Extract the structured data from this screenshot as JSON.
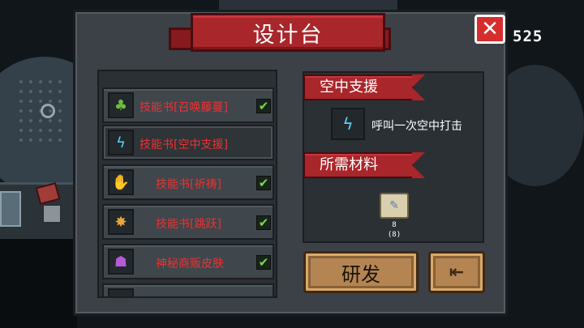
{
  "hud": {
    "score": "525"
  },
  "panel": {
    "title": "设计台",
    "close_icon": "close-x-icon"
  },
  "list": {
    "items": [
      {
        "label": "技能书[召唤藤蔓]",
        "icon": "plant-monster-icon",
        "checked": true,
        "selected": false
      },
      {
        "label": "技能书[空中支援]",
        "icon": "air-strike-icon",
        "checked": false,
        "selected": true
      },
      {
        "label": "技能书[祈祷]",
        "icon": "prayer-hand-icon",
        "checked": true,
        "selected": false
      },
      {
        "label": "技能书[跳跃]",
        "icon": "jump-blast-icon",
        "checked": true,
        "selected": false
      },
      {
        "label": "神秘商贩皮肤",
        "icon": "merchant-skin-icon",
        "checked": true,
        "selected": false
      }
    ]
  },
  "detail": {
    "name": "空中支援",
    "description": "呼叫一次空中打击",
    "icon": "air-strike-icon",
    "materials_title": "所需材料",
    "material": {
      "icon": "blueprint-scroll-icon",
      "required": "8",
      "owned": "(8)"
    }
  },
  "buttons": {
    "research_label": "研发",
    "exit_icon": "exit-door-icon"
  },
  "colors": {
    "banner_red": "#a9262b",
    "item_text_red": "#ef3131",
    "check_green": "#7ad84a",
    "button_tan": "#b48552",
    "close_red": "#d62e2e"
  }
}
